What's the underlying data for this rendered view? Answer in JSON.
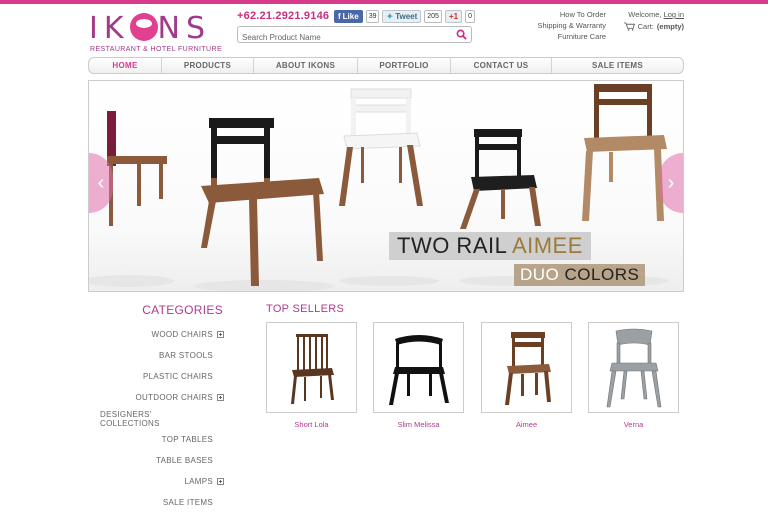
{
  "brand": {
    "logo_text": "IKONS",
    "tagline": "RESTAURANT & HOTEL FURNITURE",
    "accent_color": "#d93b8c",
    "title_color": "#b03a90"
  },
  "header": {
    "phone": "+62.21.2921.9146",
    "social": {
      "like_label": "Like",
      "like_count": "39",
      "tweet_label": "Tweet",
      "tweet_count": "205",
      "gplus_label": "+1",
      "gplus_count": "0"
    },
    "search": {
      "placeholder": "Search Product Name",
      "value": ""
    },
    "help_links": [
      "How To Order",
      "Shipping & Warranty",
      "Furniture Care"
    ],
    "account": {
      "welcome": "Welcome,",
      "login_label": "Log in",
      "cart_label": "Cart:",
      "cart_status": "(empty)"
    }
  },
  "nav": {
    "items": [
      "HOME",
      "PRODUCTS",
      "ABOUT IKONS",
      "PORTFOLIO",
      "CONTACT US",
      "SALE ITEMS"
    ],
    "active": "HOME"
  },
  "banner": {
    "caption_main": "TWO RAIL",
    "caption_accent": "AIMEE",
    "caption2_a": "DUO",
    "caption2_b": "COLORS",
    "prev_glyph": "‹",
    "next_glyph": "›"
  },
  "categories": {
    "title": "CATEGORIES",
    "items": [
      {
        "label": "WOOD CHAIRS",
        "expandable": true
      },
      {
        "label": "BAR STOOLS",
        "expandable": false
      },
      {
        "label": "PLASTIC CHAIRS",
        "expandable": false
      },
      {
        "label": "OUTDOOR CHAIRS",
        "expandable": true
      },
      {
        "label": "DESIGNERS' COLLECTIONS",
        "expandable": false
      },
      {
        "label": "TOP TABLES",
        "expandable": false
      },
      {
        "label": "TABLE BASES",
        "expandable": false
      },
      {
        "label": "LAMPS",
        "expandable": true
      },
      {
        "label": "SALE ITEMS",
        "expandable": false
      }
    ]
  },
  "top_sellers": {
    "title": "TOP SELLERS",
    "products": [
      "Short Lola",
      "Slim Melissa",
      "Aimee",
      "Verna"
    ]
  }
}
